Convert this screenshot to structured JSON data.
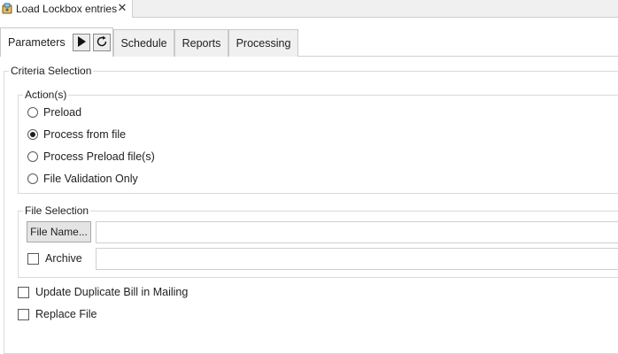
{
  "document_tab": {
    "title": "Load Lockbox entries",
    "icon": "lockbox-app-icon",
    "close_glyph": "✕"
  },
  "tabs": [
    {
      "label": "Parameters",
      "active": true
    },
    {
      "label": "Schedule",
      "active": false
    },
    {
      "label": "Reports",
      "active": false
    },
    {
      "label": "Processing",
      "active": false
    }
  ],
  "tab_buttons": {
    "run": {
      "icon": "play-icon"
    },
    "refresh": {
      "icon": "refresh-icon"
    }
  },
  "criteria": {
    "legend": "Criteria Selection",
    "actions": {
      "legend": "Action(s)",
      "options": [
        {
          "label": "Preload",
          "selected": false
        },
        {
          "label": "Process from file",
          "selected": true
        },
        {
          "label": "Process Preload file(s)",
          "selected": false
        },
        {
          "label": "File Validation Only",
          "selected": false
        }
      ]
    },
    "file_selection": {
      "legend": "File Selection",
      "file_name_button": "File Name...",
      "file_name_value": "",
      "archive_label": "Archive",
      "archive_checked": false,
      "archive_value": ""
    },
    "options": [
      {
        "label": "Update Duplicate Bill in Mailing",
        "checked": false
      },
      {
        "label": "Replace File",
        "checked": false
      }
    ]
  }
}
